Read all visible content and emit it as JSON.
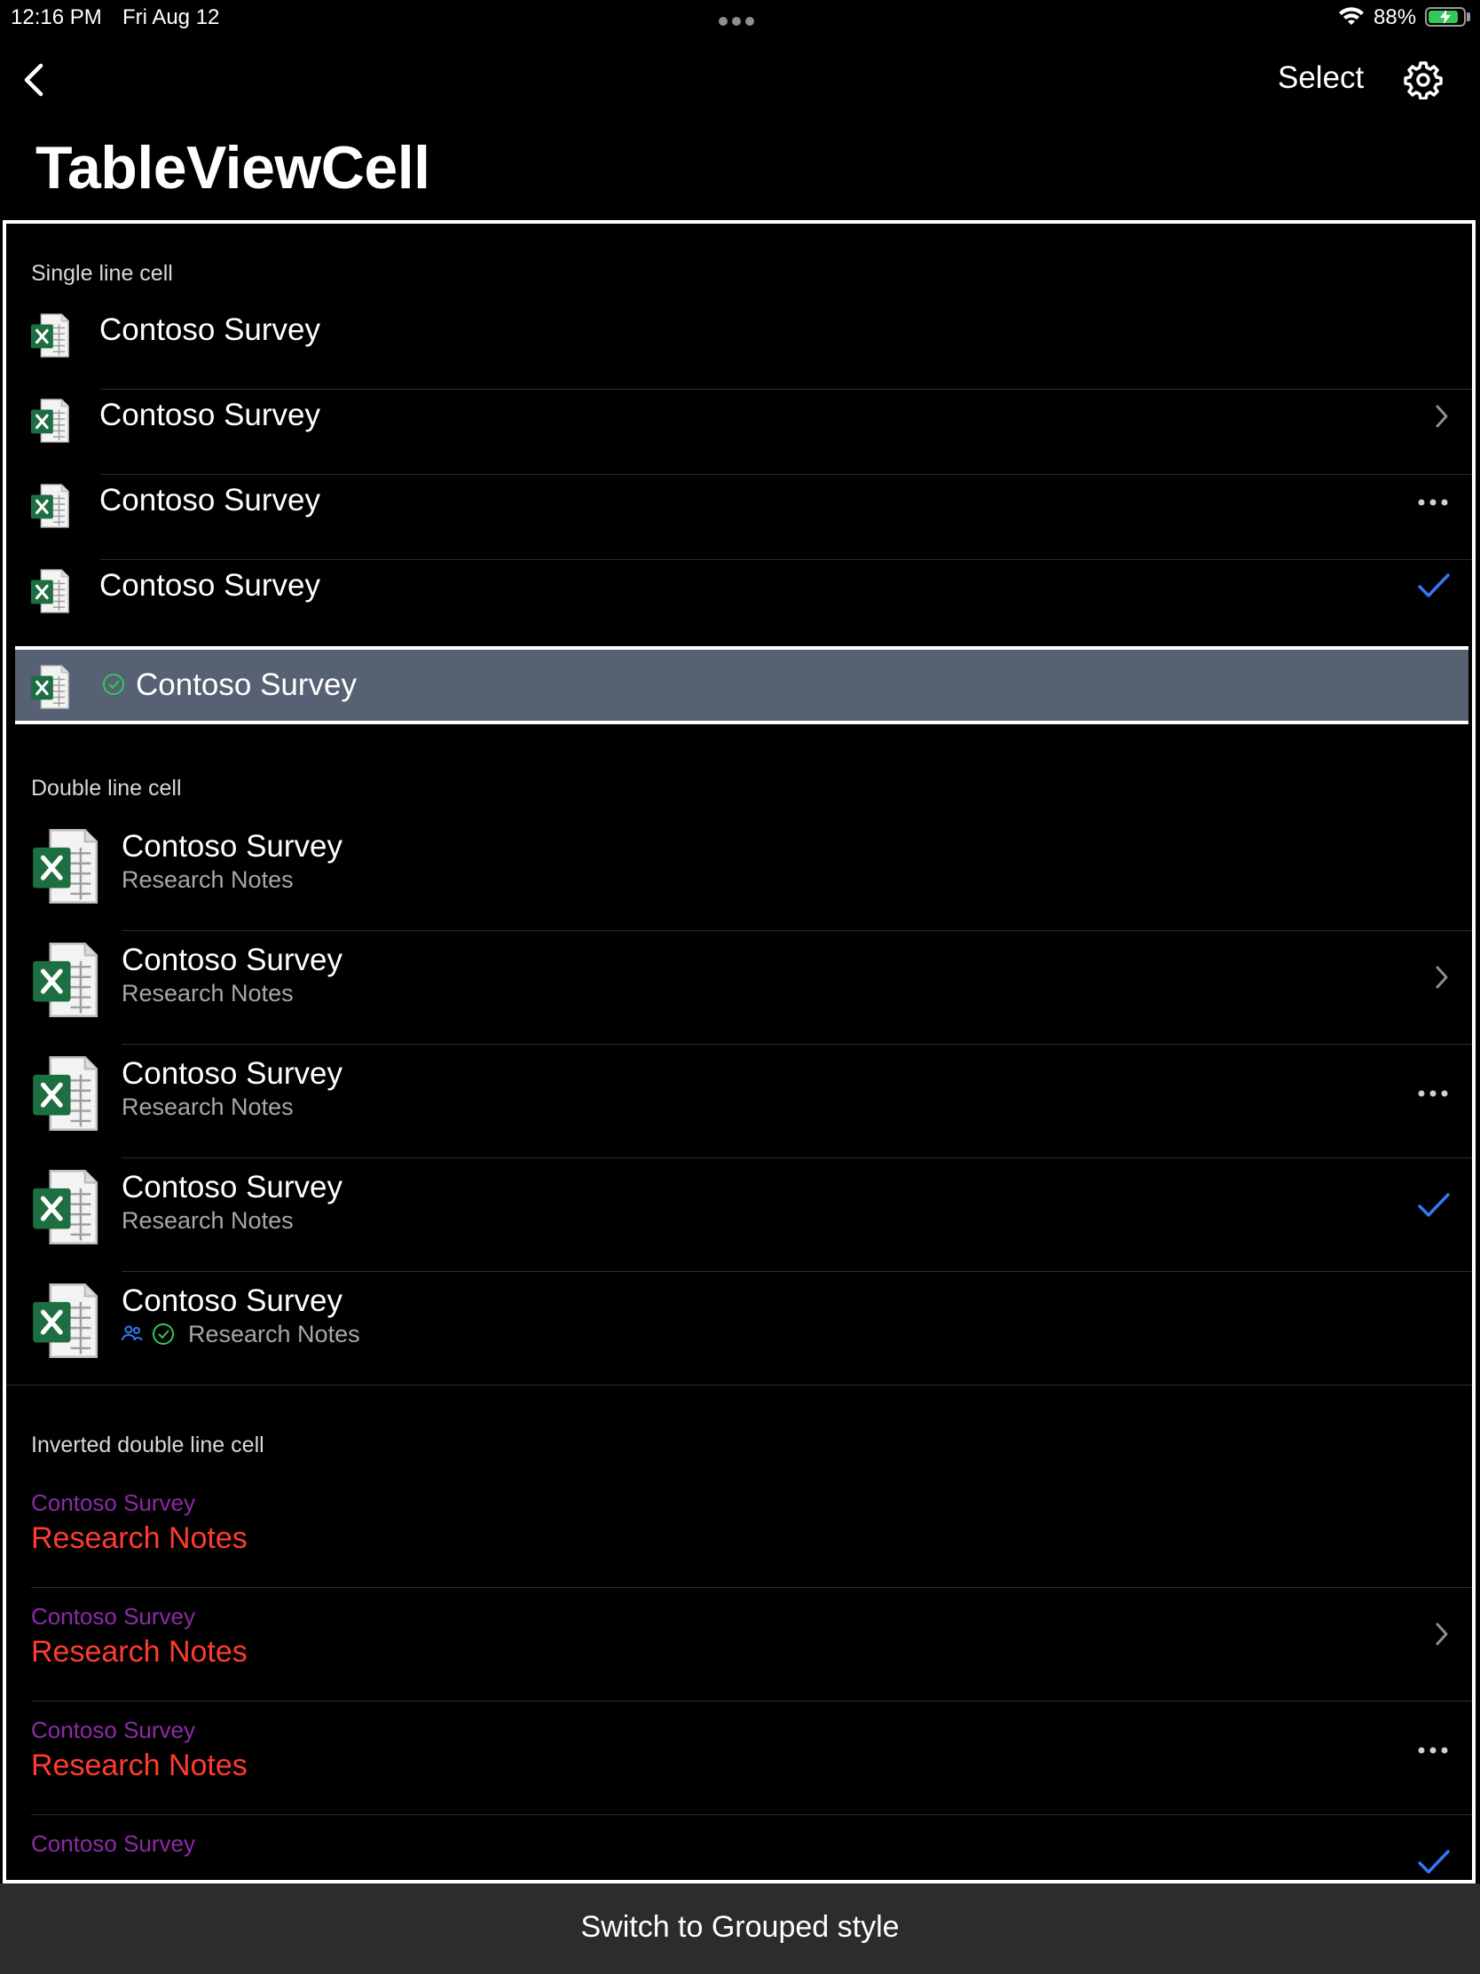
{
  "status_bar": {
    "time": "12:16 PM",
    "date": "Fri Aug 12",
    "battery_percent": "88%",
    "battery_level": 0.88,
    "wifi_icon": "wifi-icon",
    "battery_icon": "battery-charging-icon"
  },
  "nav": {
    "back_icon": "chevron-left-icon",
    "select_label": "Select",
    "settings_icon": "gear-icon",
    "title": "TableViewCell"
  },
  "sections": {
    "single": {
      "header": "Single line cell",
      "rows": [
        {
          "title": "Contoso Survey",
          "accessory": "none"
        },
        {
          "title": "Contoso Survey",
          "accessory": "chevron"
        },
        {
          "title": "Contoso Survey",
          "accessory": "more"
        },
        {
          "title": "Contoso Survey",
          "accessory": "checkmark"
        },
        {
          "title": "Contoso Survey",
          "accessory": "none",
          "selected": true,
          "status_icon": "check-circle-icon"
        }
      ]
    },
    "double": {
      "header": "Double line cell",
      "rows": [
        {
          "title": "Contoso Survey",
          "subtitle": "Research Notes",
          "accessory": "none"
        },
        {
          "title": "Contoso Survey",
          "subtitle": "Research Notes",
          "accessory": "chevron"
        },
        {
          "title": "Contoso Survey",
          "subtitle": "Research Notes",
          "accessory": "more"
        },
        {
          "title": "Contoso Survey",
          "subtitle": "Research Notes",
          "accessory": "checkmark"
        },
        {
          "title": "Contoso Survey",
          "subtitle": "Research Notes",
          "accessory": "none",
          "subtitle_icons": [
            "people-icon",
            "check-circle-icon"
          ]
        }
      ]
    },
    "inverted": {
      "header": "Inverted double line cell",
      "rows": [
        {
          "title": "Contoso Survey",
          "subtitle": "Research Notes",
          "accessory": "none"
        },
        {
          "title": "Contoso Survey",
          "subtitle": "Research Notes",
          "accessory": "chevron"
        },
        {
          "title": "Contoso Survey",
          "subtitle": "Research Notes",
          "accessory": "more"
        },
        {
          "title": "Contoso Survey",
          "subtitle": "",
          "accessory": "checkmark"
        }
      ]
    }
  },
  "bottom_bar": {
    "label": "Switch to Grouped style"
  },
  "colors": {
    "background": "#000000",
    "accent_blue": "#3478f6",
    "selected_row": "#566173",
    "inverted_title": "#8e2aa8",
    "inverted_subtitle": "#ff3b30",
    "excel_green": "#1d6f42"
  }
}
